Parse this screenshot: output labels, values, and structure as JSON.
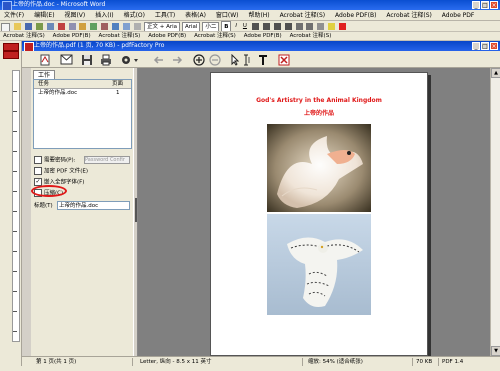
{
  "word": {
    "title": "上帝的作品.doc - Microsoft Word",
    "menu": [
      "文件(F)",
      "编辑(E)",
      "视图(V)",
      "插入(I)",
      "格式(O)",
      "工具(T)",
      "表格(A)",
      "窗口(W)",
      "帮助(H)",
      "Acrobat 注释(S)",
      "Adobe PDF(B)",
      "Acrobat 注释(S)",
      "Adobe PDF"
    ],
    "toolbar1": {
      "style": "正文 + Aria",
      "font": "Arial",
      "size": "小二",
      "bold": "B",
      "italic": "I",
      "underline": "U",
      "items2": [
        "Acrobat 注释(S)",
        "Adobe PDF(B)",
        "Acrobat 注释(S)",
        "Adobe PDF(B)",
        "Acrobat 注释(S)",
        "Adobe PDF(B)",
        "Acrobat 注释(S)"
      ]
    }
  },
  "pdf": {
    "title": "上帝的作品.pdf (1 页, 70 KB) - pdfFactory Pro"
  },
  "panel": {
    "tab": "工作",
    "list": {
      "headers": [
        "任务",
        "页面"
      ],
      "rows": [
        {
          "task": "上帝的作品.doc",
          "pages": "1"
        }
      ]
    },
    "options": [
      {
        "label": "需要密码(P):",
        "checked": false
      },
      {
        "label": "加密 PDF 文件(E)",
        "checked": false
      },
      {
        "label": "嵌入全部字体(F)",
        "checked": true
      },
      {
        "label": "压缩(C)",
        "checked": false
      }
    ],
    "password_placeholder": "Password Confir",
    "title_label": "标题(T)",
    "title_value": "上帝的作品.doc"
  },
  "document": {
    "title": "God's Artistry in the Animal Kingdom",
    "subtitle": "上帝的作品",
    "accent": "#e01818"
  },
  "status": {
    "page": "第 1 页(共 1 页)",
    "paper": "Letter, 纵向 - 8.5 x 11 英寸",
    "zoom": "缩放: 54% (适合纸张)",
    "size": "70 KB",
    "pdf_version": "PDF 1.4"
  }
}
